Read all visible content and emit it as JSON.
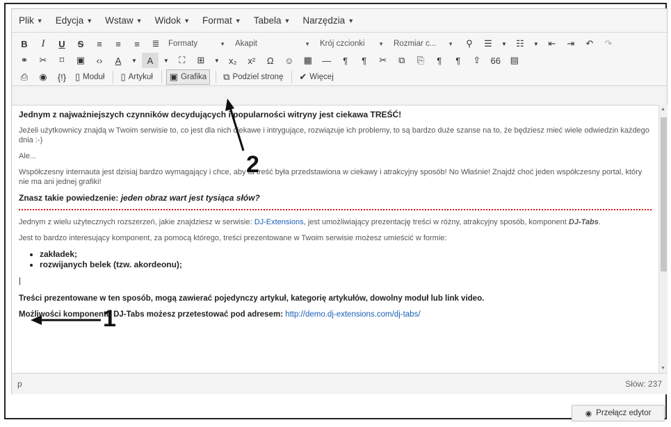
{
  "menubar": [
    "Plik",
    "Edycja",
    "Wstaw",
    "Widok",
    "Format",
    "Tabela",
    "Narzędzia"
  ],
  "toolbar": {
    "row1": {
      "format_buttons": [
        "B",
        "I",
        "U",
        "S"
      ],
      "dropdowns": {
        "formaty": "Formaty",
        "akapit": "Akapit",
        "krój": "Krój czcionki",
        "rozmiar": "Rozmiar c..."
      }
    },
    "row2": {
      "symbols": [
        "Ω",
        "x₂",
        "x²",
        "¶",
        "66"
      ]
    },
    "row3": {
      "braces": "{!}",
      "modul": "Moduł",
      "artykul": "Artykuł",
      "grafika": "Grafika",
      "podziel": "Podziel stronę",
      "wiecej": "Więcej"
    }
  },
  "content": {
    "p1": "Jednym z najważniejszych czynników decydujących i popularności witryny jest ciekawa TREŚĆ!",
    "p2": "Jeżeli użytkownicy znajdą w Twoim serwisie to, co jest dla nich ciekawe i intrygujące, rozwiązuje ich problemy, to są bardzo duże szanse na to, że będziesz mieć wiele odwiedzin każdego dnia :-)",
    "p3": "Ale...",
    "p4": "Współczesny internauta jest dzisiaj bardzo wymagający i chce, aby ta treść była przedstawiona w ciekawy i atrakcyjny sposób! No Właśnie! Znajdź choć jeden współczesny portal, który nie ma ani jednej grafiki!",
    "p5_lead": "Znasz takie powiedzenie: ",
    "p5_em": "jeden obraz wart jest tysiąca słów?",
    "p6_pre": "Jednym z wielu użytecznych rozszerzeń, jakie znajdziesz w serwisie: ",
    "p6_link": "DJ-Extensions",
    "p6_mid": ", jest umożliwiający prezentację treści w różny, atrakcyjny sposób, komponent ",
    "p6_em": "DJ-Tabs",
    "p6_end": ".",
    "p7": "Jest to bardzo interesujący komponent, za pomocą którego, treści prezentowane w Twoim serwisie możesz umieścić w formie:",
    "list": [
      "zakładek;",
      "rozwijanych belek (tzw. akordeonu);"
    ],
    "p8": "Treści prezentowane w ten sposób, mogą zawierać pojedynczy artykuł, kategorię artykułów, dowolny moduł lub link video.",
    "p9_pre": "Możliwości komponentu DJ-Tabs możesz przetestować pod adresem: ",
    "p9_link": "http://demo.dj-extensions.com/dj-tabs/"
  },
  "status": {
    "path": "p",
    "words": "Słów: 237"
  },
  "toggle_label": "Przełącz edytor",
  "annotations": {
    "one": "1",
    "two": "2"
  }
}
